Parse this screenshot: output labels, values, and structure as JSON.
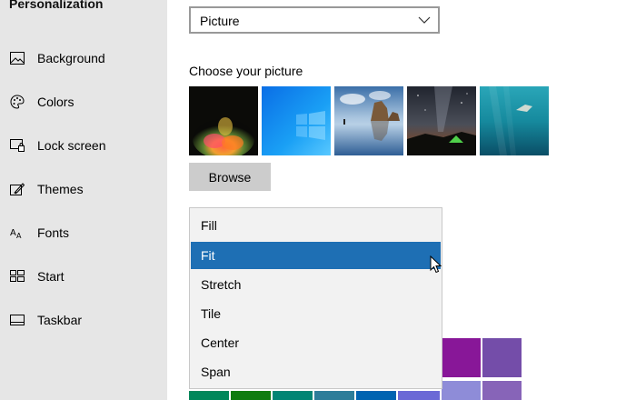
{
  "sidebar": {
    "title": "Personalization",
    "items": [
      {
        "label": "Background",
        "icon": "picture-icon"
      },
      {
        "label": "Colors",
        "icon": "palette-icon"
      },
      {
        "label": "Lock screen",
        "icon": "lock-screen-icon"
      },
      {
        "label": "Themes",
        "icon": "themes-icon"
      },
      {
        "label": "Fonts",
        "icon": "fonts-icon"
      },
      {
        "label": "Start",
        "icon": "start-icon"
      },
      {
        "label": "Taskbar",
        "icon": "taskbar-icon"
      }
    ]
  },
  "background_dropdown": {
    "value": "Picture"
  },
  "choose_picture": {
    "label": "Choose your picture"
  },
  "browse_button": {
    "label": "Browse"
  },
  "fit_menu": {
    "options": [
      "Fill",
      "Fit",
      "Stretch",
      "Tile",
      "Center",
      "Span"
    ],
    "selected": "Fit"
  },
  "colors": {
    "accent_selected": "#1e6fb4",
    "sidebar_bg": "#e6e6e6",
    "swatch_purple_dark": "#881798",
    "swatch_purple": "#744da9"
  }
}
